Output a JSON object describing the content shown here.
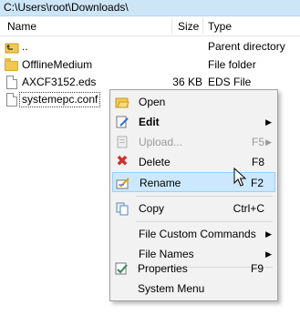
{
  "path": "C:\\Users\\root\\Downloads\\",
  "columns": {
    "name": "Name",
    "size": "Size",
    "type": "Type"
  },
  "files": [
    {
      "name": "..",
      "size": "",
      "type": "Parent directory",
      "icon": "parent-directory-icon"
    },
    {
      "name": "OfflineMedium",
      "size": "",
      "type": "File folder",
      "icon": "folder-icon"
    },
    {
      "name": "AXCF3152.eds",
      "size": "36 KB",
      "type": "EDS File",
      "icon": "file-icon"
    },
    {
      "name": "systemepc.conf",
      "size": "",
      "type": "",
      "icon": "file-icon"
    }
  ],
  "context_menu": {
    "items": [
      {
        "label": "Open",
        "shortcut": "",
        "icon": "open-folder-icon"
      },
      {
        "label": "Edit",
        "shortcut": "",
        "icon": "edit-icon",
        "submenu": true,
        "bold": true
      },
      {
        "label": "Upload...",
        "shortcut": "F5",
        "icon": "upload-icon",
        "submenu": true,
        "disabled": true
      },
      {
        "label": "Delete",
        "shortcut": "F8",
        "icon": "delete-icon"
      },
      {
        "label": "Rename",
        "shortcut": "F2",
        "icon": "rename-icon",
        "highlighted": true
      },
      {
        "label": "Copy",
        "shortcut": "Ctrl+C",
        "icon": "copy-icon"
      },
      {
        "label": "File Custom Commands",
        "shortcut": "",
        "submenu": true
      },
      {
        "label": "File Names",
        "shortcut": "",
        "submenu": true
      },
      {
        "label": "Properties",
        "shortcut": "F9",
        "icon": "properties-icon"
      },
      {
        "label": "System Menu",
        "shortcut": ""
      }
    ]
  },
  "colors": {
    "path_bar": "#cde6f7",
    "menu_bg": "#f2f2f2",
    "hover": "#cce8ff",
    "delete": "#d32f2f"
  }
}
